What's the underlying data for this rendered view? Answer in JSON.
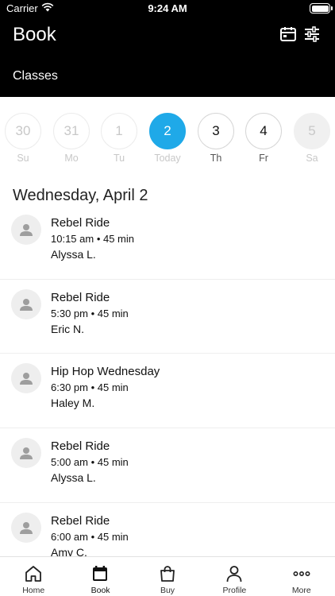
{
  "status_bar": {
    "carrier": "Carrier",
    "time": "9:24 AM"
  },
  "header": {
    "title": "Book",
    "tab": "Classes"
  },
  "days": [
    {
      "num": "30",
      "label": "Su",
      "state": "past"
    },
    {
      "num": "31",
      "label": "Mo",
      "state": "past"
    },
    {
      "num": "1",
      "label": "Tu",
      "state": "past"
    },
    {
      "num": "2",
      "label": "Today",
      "state": "today"
    },
    {
      "num": "3",
      "label": "Th",
      "state": "future"
    },
    {
      "num": "4",
      "label": "Fr",
      "state": "future"
    },
    {
      "num": "5",
      "label": "Sa",
      "state": "disabled"
    }
  ],
  "date_heading": "Wednesday, April 2",
  "classes": [
    {
      "name": "Rebel Ride",
      "time": "10:15 am • 45 min",
      "instructor": "Alyssa L."
    },
    {
      "name": "Rebel Ride",
      "time": "5:30 pm • 45 min",
      "instructor": "Eric N."
    },
    {
      "name": "Hip Hop Wednesday",
      "time": "6:30 pm • 45 min",
      "instructor": "Haley M."
    },
    {
      "name": "Rebel Ride",
      "time": "5:00 am • 45 min",
      "instructor": "Alyssa L."
    },
    {
      "name": "Rebel Ride",
      "time": "6:00 am • 45 min",
      "instructor": "Amy C."
    }
  ],
  "tabs": [
    {
      "label": "Home",
      "icon": "home-icon"
    },
    {
      "label": "Book",
      "icon": "calendar-icon",
      "active": true
    },
    {
      "label": "Buy",
      "icon": "shopping-bag-icon"
    },
    {
      "label": "Profile",
      "icon": "profile-icon"
    },
    {
      "label": "More",
      "icon": "more-icon"
    }
  ],
  "colors": {
    "accent": "#1fa9e8",
    "header_bg": "#000000"
  }
}
